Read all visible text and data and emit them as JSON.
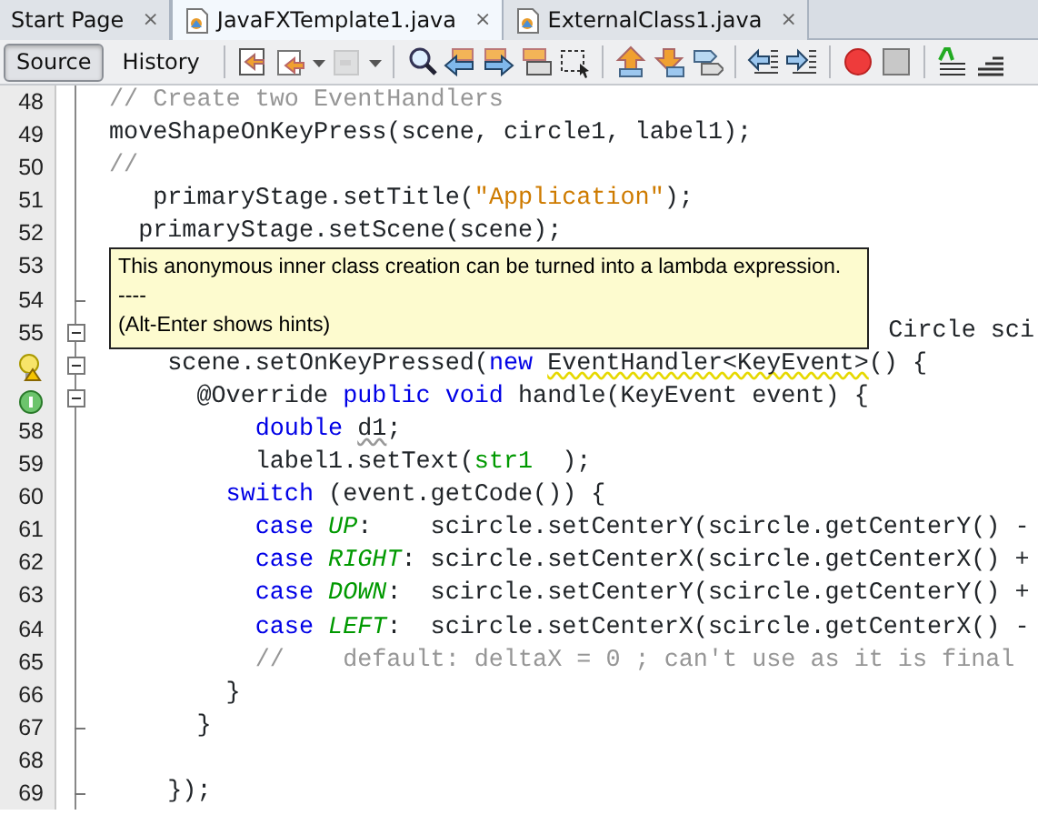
{
  "tabs": [
    {
      "label": "Start Page",
      "selected": false,
      "icon": false,
      "close": "×"
    },
    {
      "label": "JavaFXTemplate1.java",
      "selected": true,
      "icon": true,
      "close": "×"
    },
    {
      "label": "ExternalClass1.java",
      "selected": false,
      "icon": true,
      "close": "×"
    }
  ],
  "view_buttons": [
    {
      "label": "Source",
      "selected": true
    },
    {
      "label": "History",
      "selected": false
    }
  ],
  "toolbar": [
    {
      "kind": "separator"
    },
    {
      "kind": "last-edit",
      "disabled": false
    },
    {
      "kind": "back",
      "disabled": false
    },
    {
      "kind": "dropdown",
      "disabled": false
    },
    {
      "kind": "forward",
      "disabled": true
    },
    {
      "kind": "dropdown",
      "disabled": false
    },
    {
      "kind": "separator"
    },
    {
      "kind": "find",
      "disabled": false
    },
    {
      "kind": "prev",
      "disabled": false
    },
    {
      "kind": "next",
      "disabled": false
    },
    {
      "kind": "highlight",
      "disabled": false
    },
    {
      "kind": "select",
      "disabled": false
    },
    {
      "kind": "separator"
    },
    {
      "kind": "up",
      "disabled": false
    },
    {
      "kind": "down",
      "disabled": false
    },
    {
      "kind": "bookmark",
      "disabled": false
    },
    {
      "kind": "separator"
    },
    {
      "kind": "shift-left",
      "disabled": false
    },
    {
      "kind": "shift-right",
      "disabled": false
    },
    {
      "kind": "separator"
    },
    {
      "kind": "record",
      "disabled": false
    },
    {
      "kind": "stop",
      "disabled": false
    },
    {
      "kind": "separator"
    },
    {
      "kind": "comment",
      "disabled": false
    },
    {
      "kind": "uncomment",
      "disabled": false
    }
  ],
  "lines": [
    {
      "number": "48",
      "tokens": [
        {
          "t": "// Create two EventHandlers",
          "kind": "comment"
        }
      ]
    },
    {
      "number": "49",
      "tokens": [
        {
          "t": "moveShapeOnKeyPress(scene, circle1, label1);",
          "kind": "plain"
        }
      ]
    },
    {
      "number": "50",
      "tokens": [
        {
          "t": "//",
          "kind": "comment"
        }
      ]
    },
    {
      "number": "51",
      "tokens": [
        {
          "t": "   primaryStage.setTitle(",
          "kind": "plain"
        },
        {
          "t": "\"Application\"",
          "kind": "string"
        },
        {
          "t": ");",
          "kind": "plain"
        }
      ]
    },
    {
      "number": "52",
      "tokens": [
        {
          "t": "  primaryStage.setScene(scene);",
          "kind": "plain"
        }
      ]
    },
    {
      "number": "53"
    },
    {
      "number": "54",
      "fold_end": true
    },
    {
      "number": "55",
      "fold_toggle": true,
      "covered": true,
      "tokens": [
        {
          "t": "Circle sci",
          "kind": "plain"
        }
      ]
    },
    {
      "fold_toggle": true,
      "hint_marker": true,
      "tokens": [
        {
          "t": "    scene.setOnKeyPressed(",
          "kind": "plain"
        },
        {
          "t": "new ",
          "kind": "keyword"
        },
        {
          "t": "EventHandler<KeyEvent>",
          "kind": "warning"
        },
        {
          "t": "() {",
          "kind": "plain"
        }
      ]
    },
    {
      "fold_toggle": true,
      "override_marker": true,
      "tokens": [
        {
          "t": "      @Override ",
          "kind": "plain"
        },
        {
          "t": "public void",
          "kind": "keyword"
        },
        {
          "t": " handle(KeyEvent event) {",
          "kind": "plain"
        }
      ]
    },
    {
      "number": "58",
      "tokens": [
        {
          "t": "          double ",
          "kind": "keyword"
        },
        {
          "t": "d1",
          "kind": "unused"
        },
        {
          "t": ";",
          "kind": "plain"
        }
      ]
    },
    {
      "number": "59",
      "tokens": [
        {
          "t": "          label1.setText(",
          "kind": "plain"
        },
        {
          "t": "str1",
          "kind": "field"
        },
        {
          "t": "  );",
          "kind": "plain"
        }
      ]
    },
    {
      "number": "60",
      "tokens": [
        {
          "t": "        switch",
          "kind": "keyword"
        },
        {
          "t": " (event.getCode()) {",
          "kind": "plain"
        }
      ]
    },
    {
      "number": "61",
      "tokens": [
        {
          "t": "          case ",
          "kind": "keyword"
        },
        {
          "t": "UP",
          "kind": "constant"
        },
        {
          "t": ":    scircle.setCenterY(scircle.getCenterY() -",
          "kind": "plain"
        }
      ]
    },
    {
      "number": "62",
      "tokens": [
        {
          "t": "          case ",
          "kind": "keyword"
        },
        {
          "t": "RIGHT",
          "kind": "constant"
        },
        {
          "t": ": scircle.setCenterX(scircle.getCenterX() +",
          "kind": "plain"
        }
      ]
    },
    {
      "number": "63",
      "tokens": [
        {
          "t": "          case ",
          "kind": "keyword"
        },
        {
          "t": "DOWN",
          "kind": "constant"
        },
        {
          "t": ":  scircle.setCenterY(scircle.getCenterY() +",
          "kind": "plain"
        }
      ]
    },
    {
      "number": "64",
      "tokens": [
        {
          "t": "          case ",
          "kind": "keyword"
        },
        {
          "t": "LEFT",
          "kind": "constant"
        },
        {
          "t": ":  scircle.setCenterX(scircle.getCenterX() -",
          "kind": "plain"
        }
      ]
    },
    {
      "number": "65",
      "tokens": [
        {
          "t": "          //    default: deltaX = 0 ; can't use as it is final",
          "kind": "comment"
        }
      ]
    },
    {
      "number": "66",
      "tokens": [
        {
          "t": "        }",
          "kind": "plain"
        }
      ]
    },
    {
      "number": "67",
      "fold_end": true,
      "tokens": [
        {
          "t": "      }",
          "kind": "plain"
        }
      ]
    },
    {
      "number": "68"
    },
    {
      "number": "69",
      "fold_end": true,
      "tokens": [
        {
          "t": "    });",
          "kind": "plain"
        }
      ]
    }
  ],
  "tooltip": {
    "lines": [
      "This anonymous inner class creation can be turned into a lambda expression.",
      "----",
      "(Alt-Enter shows hints)"
    ]
  }
}
